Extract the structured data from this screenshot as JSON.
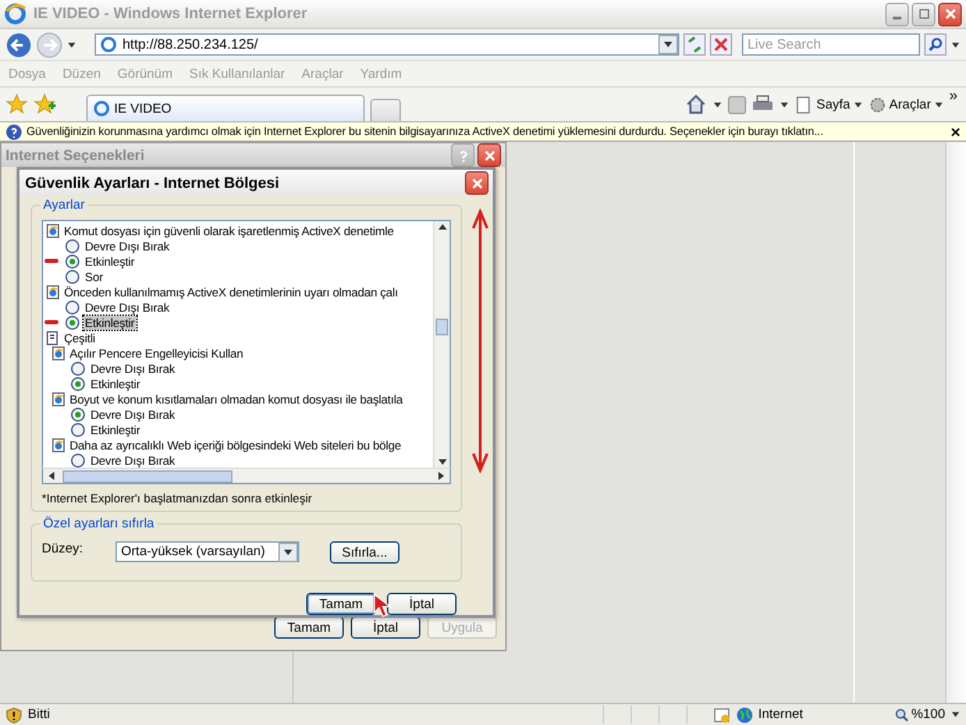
{
  "window": {
    "title": "IE VIDEO - Windows Internet Explorer"
  },
  "address_bar": {
    "url": "http://88.250.234.125/"
  },
  "search": {
    "placeholder": "Live Search"
  },
  "menu": [
    "Dosya",
    "Düzen",
    "Görünüm",
    "Sık Kullanılanlar",
    "Araçlar",
    "Yardım"
  ],
  "tabs": [
    {
      "label": "IE VIDEO",
      "selected": true
    }
  ],
  "toolbar": {
    "page": "Sayfa",
    "tools": "Araçlar",
    "more": "»"
  },
  "info_bar": {
    "text": "Güvenliğinizin korunmasına yardımcı olmak için Internet Explorer bu sitenin bilgisayarınıza ActiveX denetimi yüklemesini durdurdu. Seçenekler için burayı tıklatın...",
    "close": "×"
  },
  "options_dialog": {
    "title": "Internet Seçenekleri",
    "buttons": [
      {
        "label": "Tamam",
        "disabled": false
      },
      {
        "label": "İptal",
        "disabled": false
      },
      {
        "label": "Uygula",
        "disabled": true
      }
    ]
  },
  "security_dialog": {
    "title": "Güvenlik Ayarları - Internet Bölgesi",
    "group": "Ayarlar",
    "settings": [
      {
        "kind": "setting",
        "label": "Komut dosyası için güvenli olarak işaretlenmiş ActiveX denetimle",
        "options": [
          {
            "label": "Devre Dışı Bırak",
            "selected": false,
            "focused": false,
            "annotated": false
          },
          {
            "label": "Etkinleştir",
            "selected": true,
            "focused": false,
            "annotated": true
          },
          {
            "label": "Sor",
            "selected": false,
            "focused": false,
            "annotated": false
          }
        ]
      },
      {
        "kind": "setting",
        "label": "Önceden kullanılmamış ActiveX denetimlerinin uyarı olmadan çalı",
        "options": [
          {
            "label": "Devre Dışı Bırak",
            "selected": false,
            "focused": false,
            "annotated": false
          },
          {
            "label": "Etkinleştir",
            "selected": true,
            "focused": true,
            "annotated": true
          }
        ]
      },
      {
        "kind": "category",
        "label": "Çeşitli",
        "children": [
          {
            "kind": "setting",
            "label": "Açılır Pencere Engelleyicisi Kullan",
            "options": [
              {
                "label": "Devre Dışı Bırak",
                "selected": false,
                "focused": false,
                "annotated": false
              },
              {
                "label": "Etkinleştir",
                "selected": true,
                "focused": false,
                "annotated": false
              }
            ]
          },
          {
            "kind": "setting",
            "label": "Boyut ve konum kısıtlamaları olmadan komut dosyası ile başlatıla",
            "options": [
              {
                "label": "Devre Dışı Bırak",
                "selected": true,
                "focused": false,
                "annotated": false
              },
              {
                "label": "Etkinleştir",
                "selected": false,
                "focused": false,
                "annotated": false
              }
            ]
          },
          {
            "kind": "setting",
            "label": "Daha az ayrıcalıklı Web içeriği bölgesindeki Web siteleri bu bölge",
            "options": [
              {
                "label": "Devre Dışı Bırak",
                "selected": false,
                "focused": false,
                "annotated": false
              }
            ]
          }
        ]
      }
    ],
    "footnote": "*Internet Explorer'ı başlatmanızdan sonra etkinleşir",
    "reset_group": "Özel ayarları sıfırla",
    "level_label": "Düzey:",
    "level_value": "Orta-yüksek (varsayılan)",
    "reset_button": "Sıfırla...",
    "buttons": [
      {
        "label": "Tamam",
        "default": true
      },
      {
        "label": "İptal",
        "default": false
      }
    ]
  },
  "status_bar": {
    "text": "Bitti",
    "zone": "Internet",
    "zoom": "%100"
  }
}
